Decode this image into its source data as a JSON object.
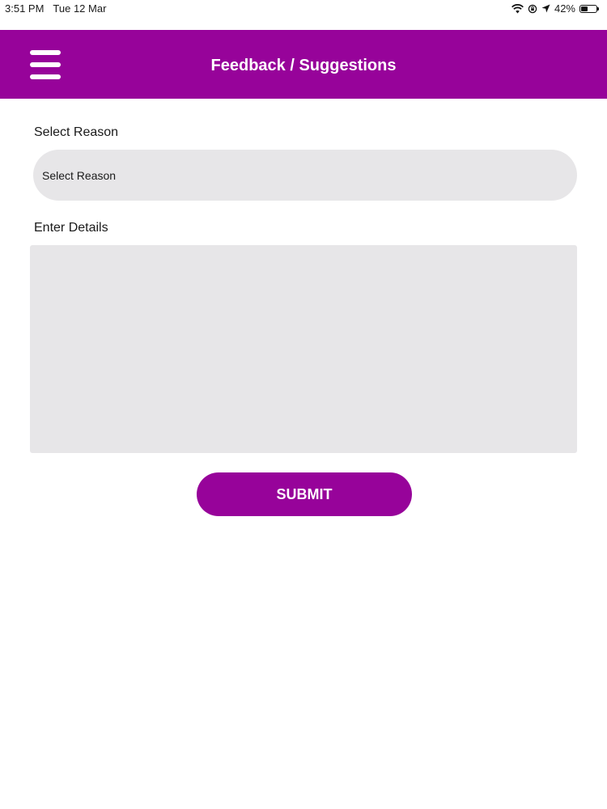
{
  "status_bar": {
    "time": "3:51 PM",
    "date": "Tue 12 Mar",
    "battery_percent": "42%",
    "battery_level": 0.42,
    "icons": [
      "wifi-icon",
      "rotation-lock-icon",
      "location-arrow-icon",
      "battery-icon"
    ]
  },
  "header": {
    "title": "Feedback / Suggestions",
    "menu_icon": "hamburger-menu-icon",
    "background_color": "#97039a"
  },
  "form": {
    "reason_label": "Select Reason",
    "reason_select_value": "Select Reason",
    "details_label": "Enter Details",
    "details_value": "",
    "submit_label": "SUBMIT"
  },
  "colors": {
    "accent": "#97039a",
    "field_background": "#e7e6e8"
  }
}
